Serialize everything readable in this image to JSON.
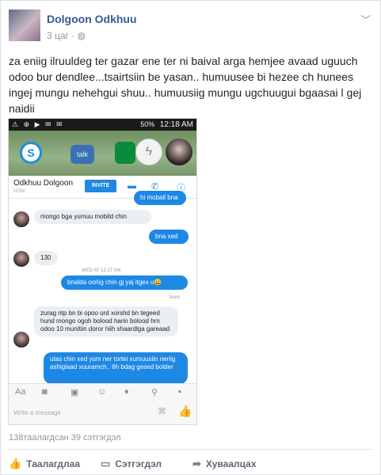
{
  "post": {
    "author": "Dolgoon Odkhuu",
    "time": "3 цаг",
    "privacy_icon": "globe-icon",
    "menu_icon": "chevron-down-icon",
    "text": "za eniig ilruuldeg ter gazar ene ter ni baival arga hemjee avaad uguuch odoo bur dendlee...tsairtsiin be yasan.. humuusee bi hezee ch hunees ingej mungu nehehgui shuu.. humuusiig mungu ugchuugui bgaasai l gej naidii"
  },
  "screenshot": {
    "status": {
      "left_icons": "⚠ ⊕ ▶ ✉ ✉",
      "battery": "50%",
      "time": "12:18 AM"
    },
    "launcher": {
      "app_label": "talk"
    },
    "header": {
      "contact_name": "Odkhuu Dolgoon",
      "presence": "NOW",
      "invite_label": "INVITE"
    },
    "messages": [
      {
        "dir": "out",
        "text": "hi mobail bna"
      },
      {
        "dir": "in",
        "text": "mongo bga yumuu mobild chin"
      },
      {
        "dir": "out",
        "text": "bna xed"
      },
      {
        "dir": "in",
        "text": "130"
      },
      {
        "dir": "out",
        "text": "bnalda ooriig chin gj yaj itgex u😀"
      },
      {
        "dir": "in",
        "text": "zurag ntp bn bi opoo urd xorshd bn tegeed hund mongo ogoh bolood harin bolood hrn odoo 10 munitiin doror hiih shaardlga gareaad"
      },
      {
        "dir": "out",
        "text": "utas chin xed yum ner tortei xumuusiin neriig ashiglaad xuuramch.. 6h bdag gesed bolder"
      }
    ],
    "date_sep": "WED AT 12:17 AM",
    "seen": "Seen",
    "composer": {
      "text_tool": "Aa",
      "placeholder": "Write a message"
    }
  },
  "counts": {
    "likes": "138таалагдсан",
    "comments": "39 сэтгэгдэл"
  },
  "actions": {
    "like": "Таалагдлаа",
    "comment": "Сэтгэгдэл",
    "share": "Хуваалцах"
  }
}
